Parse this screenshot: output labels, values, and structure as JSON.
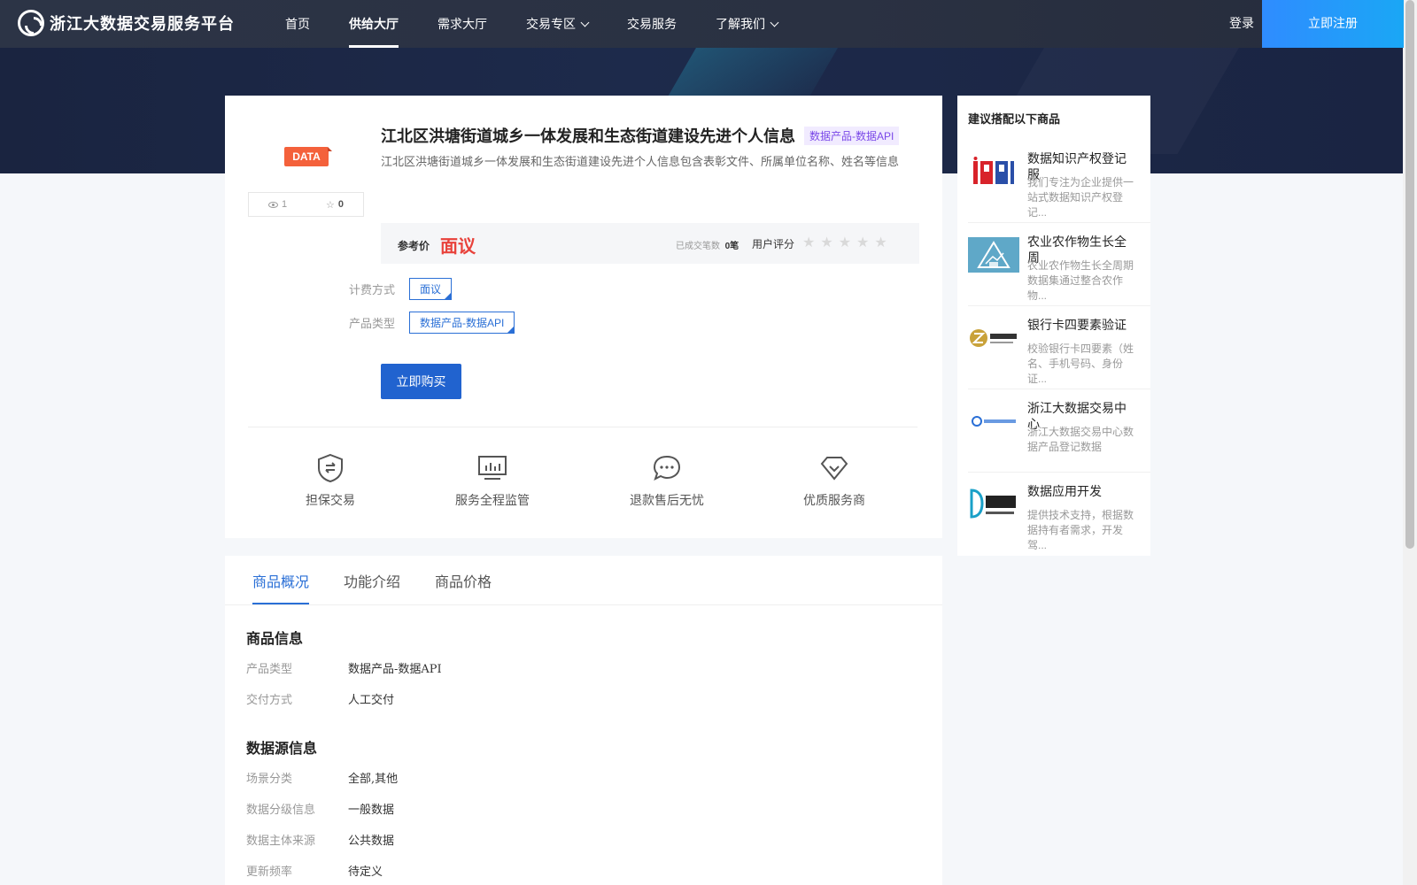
{
  "nav": {
    "logo_text": "浙江大数据交易服务平台",
    "items": [
      {
        "label": "首页"
      },
      {
        "label": "供给大厅"
      },
      {
        "label": "需求大厅"
      },
      {
        "label": "交易专区"
      },
      {
        "label": "交易服务"
      },
      {
        "label": "了解我们"
      }
    ],
    "login": "登录",
    "register": "立即注册"
  },
  "product": {
    "badge": "DATA",
    "views": "1",
    "favorites": "0",
    "title": "江北区洪塘街道城乡一体发展和生态街道建设先进个人信息",
    "type_tag": "数据产品-数据API",
    "description": "江北区洪塘街道城乡一体发展和生态街道建设先进个人信息包含表彰文件、所属单位名称、姓名等信息",
    "price_label": "参考价",
    "price_value": "面议",
    "deal_label": "已成交笔数",
    "deal_value": "0笔",
    "rating_label": "用户评分",
    "rating_value": 0,
    "billing_label": "计费方式",
    "billing_value": "面议",
    "ptype_label": "产品类型",
    "ptype_value": "数据产品-数据API",
    "buy_button": "立即购买"
  },
  "features": [
    {
      "label": "担保交易",
      "icon": "shield-exchange-icon"
    },
    {
      "label": "服务全程监管",
      "icon": "monitor-chart-icon"
    },
    {
      "label": "退款售后无忧",
      "icon": "chat-bubble-icon"
    },
    {
      "label": "优质服务商",
      "icon": "diamond-check-icon"
    }
  ],
  "tabs": [
    {
      "label": "商品概况"
    },
    {
      "label": "功能介绍"
    },
    {
      "label": "商品价格"
    }
  ],
  "details": {
    "product_info_title": "商品信息",
    "product_info": [
      {
        "label": "产品类型",
        "value": "数据产品-数据API"
      },
      {
        "label": "交付方式",
        "value": "人工交付"
      }
    ],
    "source_info_title": "数据源信息",
    "source_info": [
      {
        "label": "场景分类",
        "value": "全部,其他"
      },
      {
        "label": "数据分级信息",
        "value": "一般数据"
      },
      {
        "label": "数据主体来源",
        "value": "公共数据"
      },
      {
        "label": "更新频率",
        "value": "待定义"
      }
    ]
  },
  "sidebar": {
    "title": "建议搭配以下商品",
    "items": [
      {
        "name": "数据知识产权登记服",
        "desc": "我们专注为企业提供一站式数据知识产权登记..."
      },
      {
        "name": "农业农作物生长全周",
        "desc": "农业农作物生长全周期数据集通过整合农作物..."
      },
      {
        "name": "银行卡四要素验证",
        "desc": "校验银行卡四要素（姓名、手机号码、身份证..."
      },
      {
        "name": "浙江大数据交易中心",
        "desc": "浙江大数据交易中心数据产品登记数据"
      },
      {
        "name": "数据应用开发",
        "desc": "提供技术支持，根据数据持有者需求，开发驾..."
      }
    ]
  },
  "colors": {
    "primary": "#2163cf",
    "price_red": "#e8423b",
    "badge_orange": "#f4613b",
    "tag_purple": "#7a48e8"
  }
}
